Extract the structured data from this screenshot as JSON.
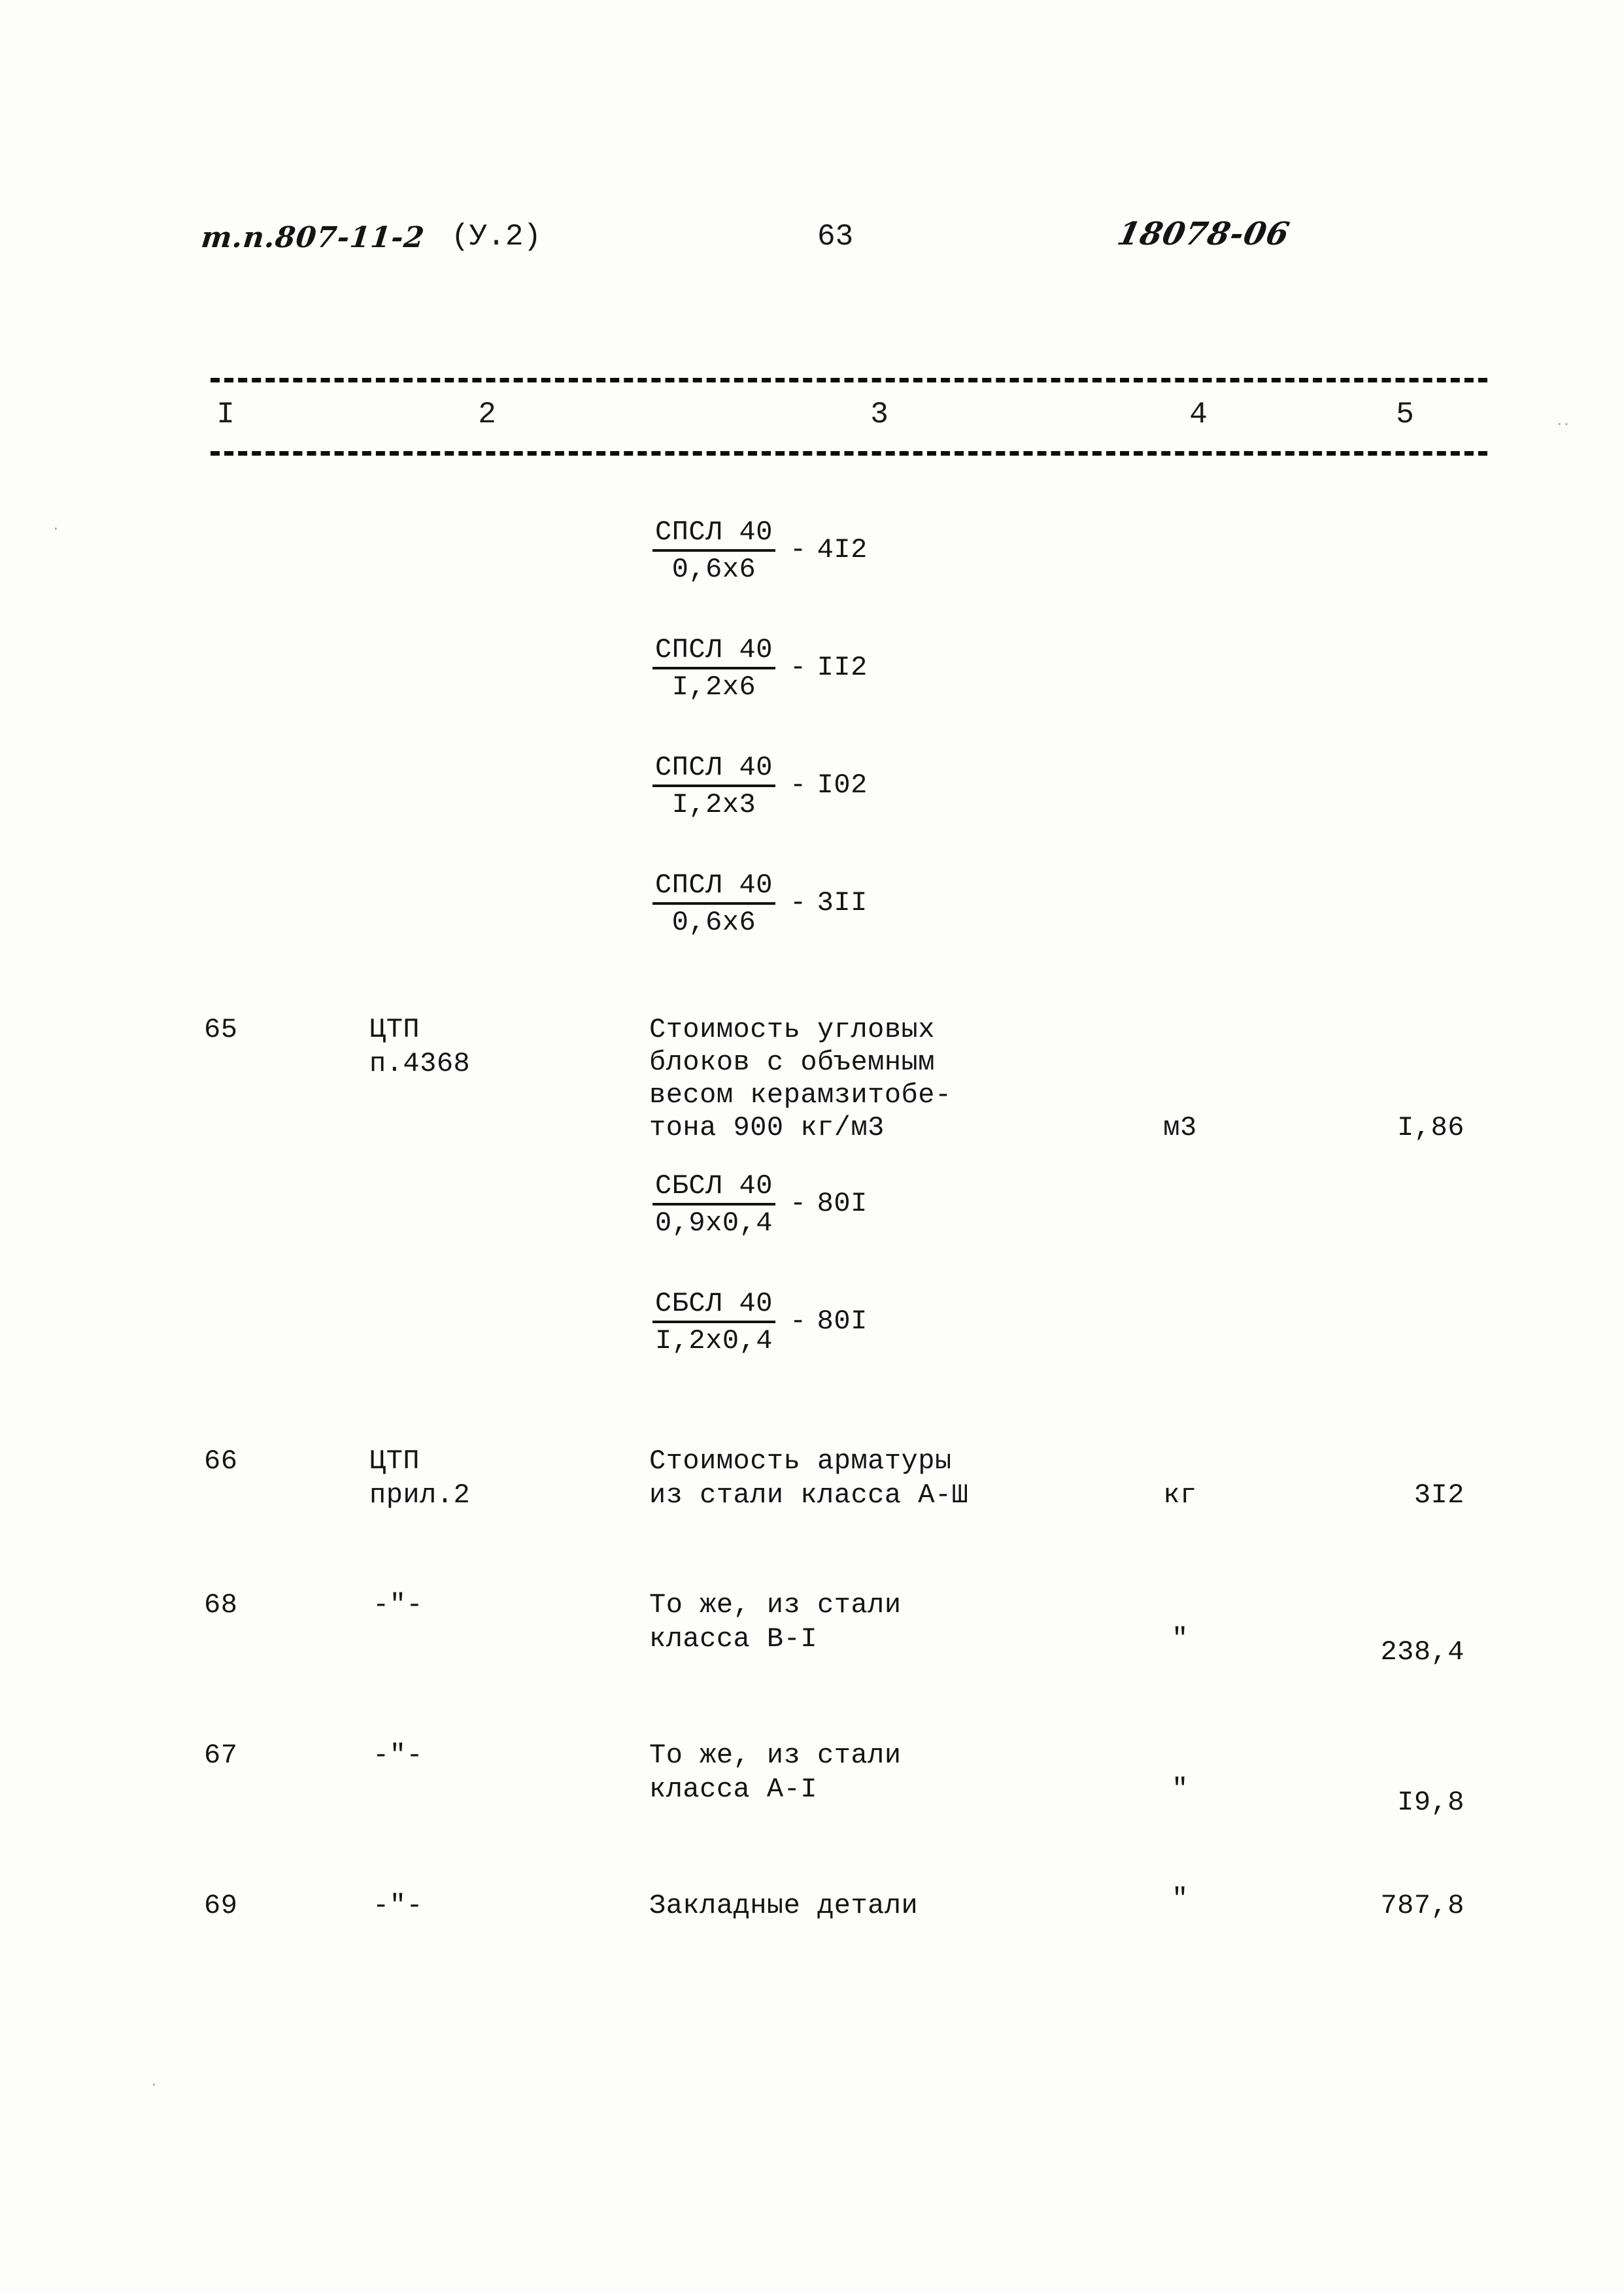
{
  "header": {
    "project_code": "т.п.807-11-2",
    "project_code_suffix": "(У.2)",
    "page_number": "63",
    "document_number": "18078-06"
  },
  "table": {
    "column_headers": [
      "I",
      "2",
      "3",
      "4",
      "5"
    ],
    "top_block_formulas": [
      {
        "numerator": "СПСЛ 40",
        "denominator": "0,6х6",
        "separator": "-",
        "value": "4I2"
      },
      {
        "numerator": "СПСЛ 40",
        "denominator": "I,2х6",
        "separator": "-",
        "value": "II2"
      },
      {
        "numerator": "СПСЛ 40",
        "denominator": "I,2х3",
        "separator": "-",
        "value": "I02"
      },
      {
        "numerator": "СПСЛ 40",
        "denominator": "0,6х6",
        "separator": "-",
        "value": "3II"
      }
    ],
    "rows": [
      {
        "num": "65",
        "code_line1": "ЦТП",
        "code_line2": "п.4368",
        "desc_lines": [
          "Стоимость угловых",
          "блоков с объемным",
          "весом керамзитобе-",
          "тона 900 кг/м3"
        ],
        "unit": "м3",
        "qty": "I,86",
        "formulas": [
          {
            "numerator": "СБСЛ 40",
            "denominator": "0,9х0,4",
            "separator": "-",
            "value": "80I"
          },
          {
            "numerator": "СБСЛ 40",
            "denominator": "I,2х0,4",
            "separator": "-",
            "value": "80I"
          }
        ]
      },
      {
        "num": "66",
        "code_line1": "ЦТП",
        "code_line2": "прил.2",
        "desc_lines": [
          "Стоимость арматуры",
          "из стали класса А-Ш"
        ],
        "unit": "кг",
        "qty": "3I2"
      },
      {
        "num": "68",
        "code_line1": "-\"-",
        "code_line2": "",
        "desc_lines": [
          "То же, из стали",
          "класса В-I"
        ],
        "unit": "\"",
        "qty": "238,4"
      },
      {
        "num": "67",
        "code_line1": "-\"-",
        "code_line2": "",
        "desc_lines": [
          "То же, из стали",
          "класса А-I"
        ],
        "unit": "\"",
        "qty": "I9,8"
      },
      {
        "num": "69",
        "code_line1": "-\"-",
        "code_line2": "",
        "desc_lines": [
          "Закладные детали"
        ],
        "unit": "\"",
        "qty": "787,8"
      }
    ]
  }
}
